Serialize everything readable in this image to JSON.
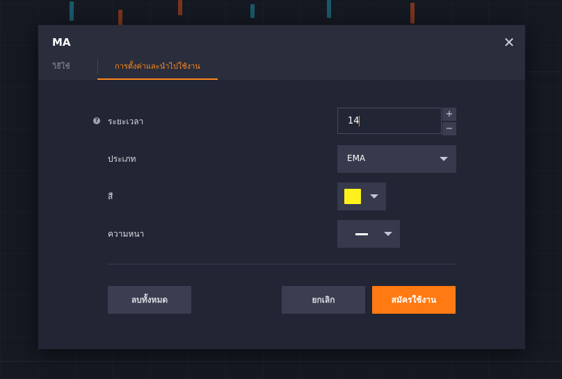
{
  "dialog": {
    "title": "MA",
    "close_label": "✕"
  },
  "tabs": [
    {
      "label": "วิธีใช้"
    },
    {
      "label": "การตั้งค่าและนำไปใช้งาน"
    }
  ],
  "form": {
    "period": {
      "label": "ระยะเวลา",
      "value": "14",
      "help_icon": "?",
      "plus": "+",
      "minus": "−"
    },
    "type": {
      "label": "ประเภท",
      "value": "EMA"
    },
    "color": {
      "label": "สี",
      "value": "#fff21c"
    },
    "thickness": {
      "label": "ความหนา"
    }
  },
  "buttons": {
    "reset": "ลบทั้งหมด",
    "cancel": "ยกเลิก",
    "apply": "สมัครใช้งาน"
  },
  "colors": {
    "accent": "#ff7a12",
    "tab_active": "#ff8a1e",
    "dialog_bg": "#222533",
    "header_bg": "#2a2d3c"
  }
}
